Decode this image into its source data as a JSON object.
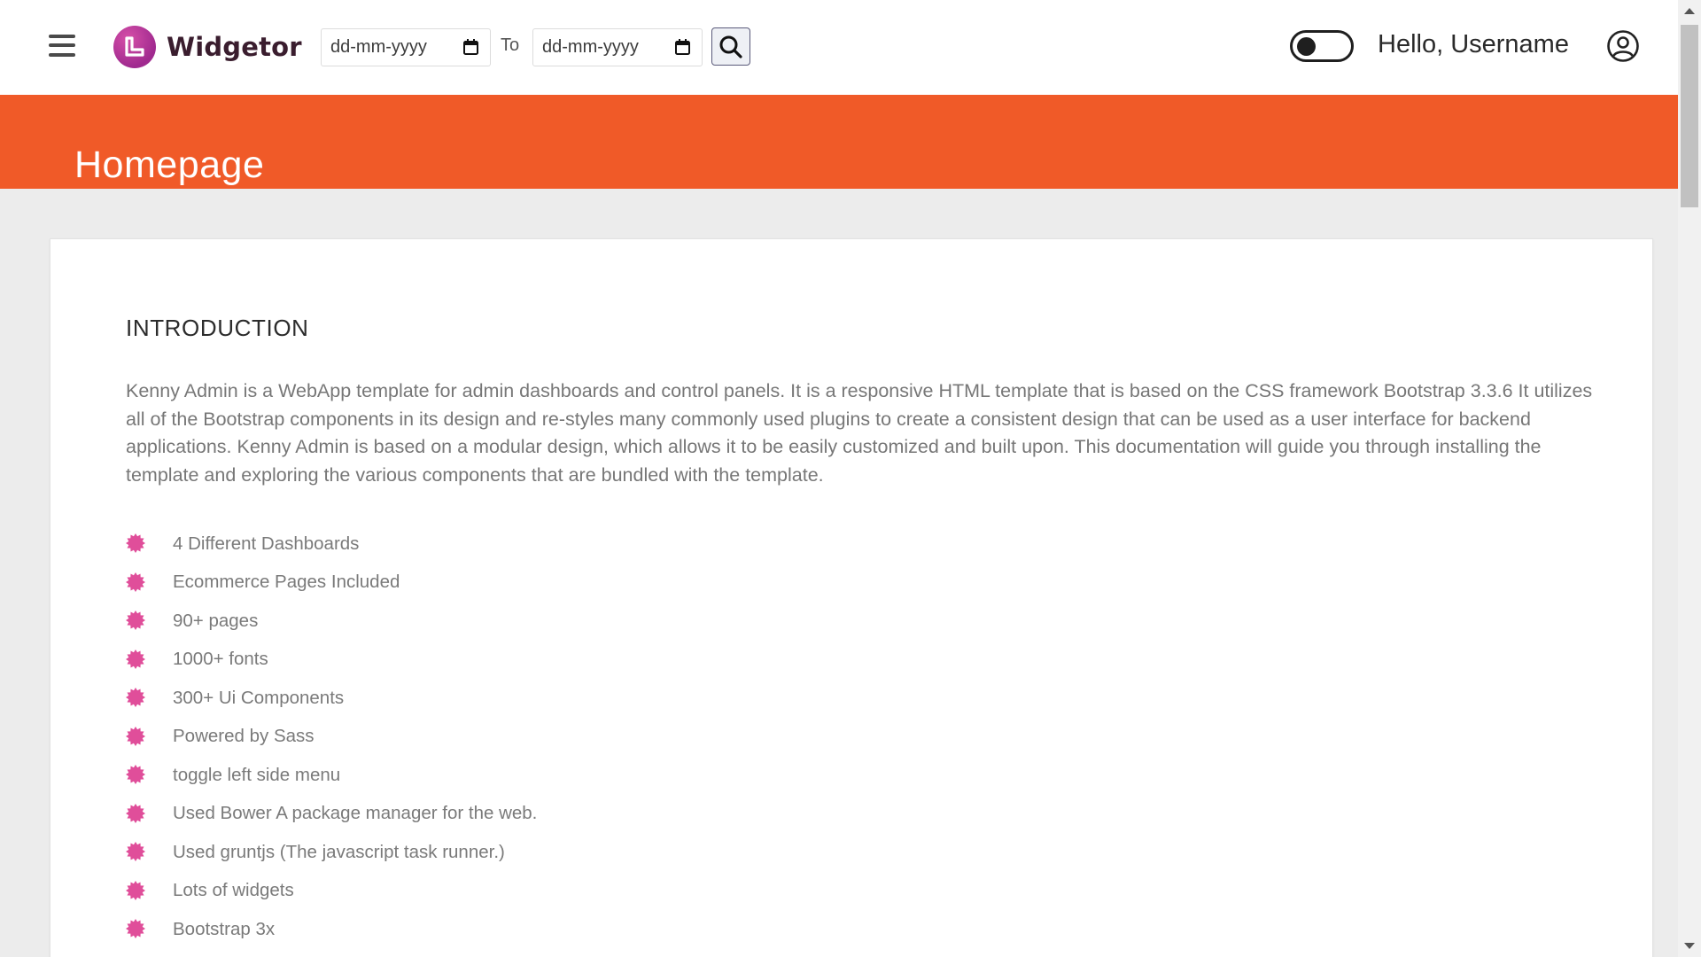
{
  "header": {
    "brand_name": "Widgetor",
    "date_from": {
      "placeholder": "dd-mm-yyyy"
    },
    "to_label": "To",
    "date_to": {
      "placeholder": "dd-mm-yyyy"
    },
    "theme_toggle_on": false,
    "greeting": "Hello, Username"
  },
  "banner": {
    "title": "Homepage",
    "color": "#f05a28"
  },
  "content": {
    "section_title": "INTRODUCTION",
    "intro": "Kenny Admin is a WebApp template for admin dashboards and control panels. It is a responsive HTML template that is based on the CSS framework Bootstrap 3.3.6 It utilizes all of the Bootstrap components in its design and re-styles many commonly used plugins to create a consistent design that can be used as a user interface for backend applications. Kenny Admin is based on a modular design, which allows it to be easily customized and built upon. This documentation will guide you through installing the template and exploring the various components that are bundled with the template.",
    "features": [
      "4 Different Dashboards",
      "Ecommerce Pages Included",
      "90+ pages",
      "1000+ fonts",
      "300+ Ui Components",
      "Powered by Sass",
      "toggle left side menu",
      "Used Bower A package manager for the web.",
      "Used gruntjs (The javascript task runner.)",
      "Lots of widgets",
      "Bootstrap 3x"
    ],
    "bullet_color": "#e04e9a"
  }
}
